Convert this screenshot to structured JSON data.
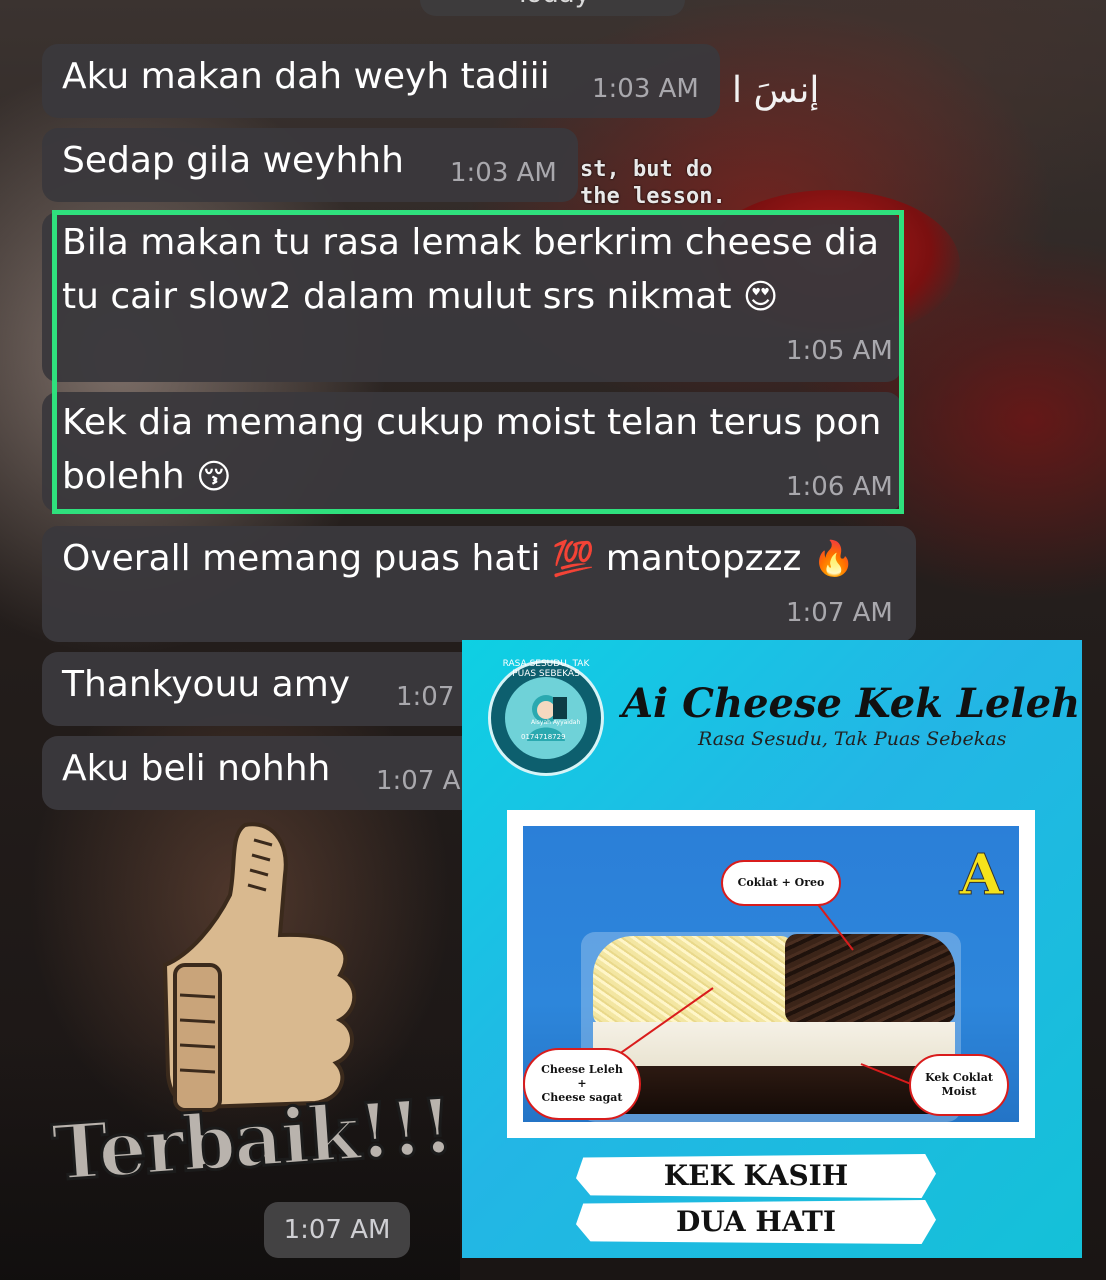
{
  "date_header": "Today",
  "background": {
    "arabic_text": "إنسَ ا",
    "mono_lines": [
      "st, but do",
      "the lesson."
    ]
  },
  "messages": [
    {
      "text": "Aku makan dah weyh tadiii",
      "time": "1:03 AM"
    },
    {
      "text": "Sedap gila weyhhh",
      "time": "1:03 AM"
    },
    {
      "line1": "Bila makan tu rasa lemak berkrim cheese dia",
      "line2": "tu cair slow2 dalam mulut srs nikmat",
      "emoji": "😍",
      "time": "1:05 AM"
    },
    {
      "line1": "Kek dia memang cukup moist telan terus pon",
      "line2": "bolehh",
      "emoji": "😚",
      "time": "1:06 AM"
    },
    {
      "text_a": "Overall memang puas hati",
      "emoji_a": "💯",
      "text_b": "mantopzzz",
      "emoji_b": "🔥",
      "time": "1:07 AM"
    },
    {
      "text": "Thankyouu amy",
      "time": "1:07"
    },
    {
      "text": "Aku beli nohhh",
      "time": "1:07 A"
    }
  ],
  "sticker": {
    "text": "Terbaik!!!",
    "time": "1:07 AM"
  },
  "colors": {
    "bubble": "#3a383c",
    "highlight": "#2fe07d",
    "card_bg": "#14c1d8",
    "banner_text": "#111111"
  },
  "product_card": {
    "logo": {
      "ring_text": "RASA SESUDU, TAK PUAS SEBEKAS",
      "brand": "Aisyah Ayyaidah",
      "phone": "0174718729"
    },
    "title": "Ai Cheese Kek Leleh",
    "subtitle": "Rasa Sesudu, Tak Puas Sebekas",
    "variant_letter": "A",
    "callouts": {
      "top": "Coklat + Oreo",
      "left_line1": "Cheese Leleh",
      "left_line2": "+",
      "left_line3": "Cheese sagat",
      "right_line1": "Kek Coklat",
      "right_line2": "Moist"
    },
    "banner_line1": "KEK KASIH",
    "banner_line2": "DUA HATI"
  }
}
